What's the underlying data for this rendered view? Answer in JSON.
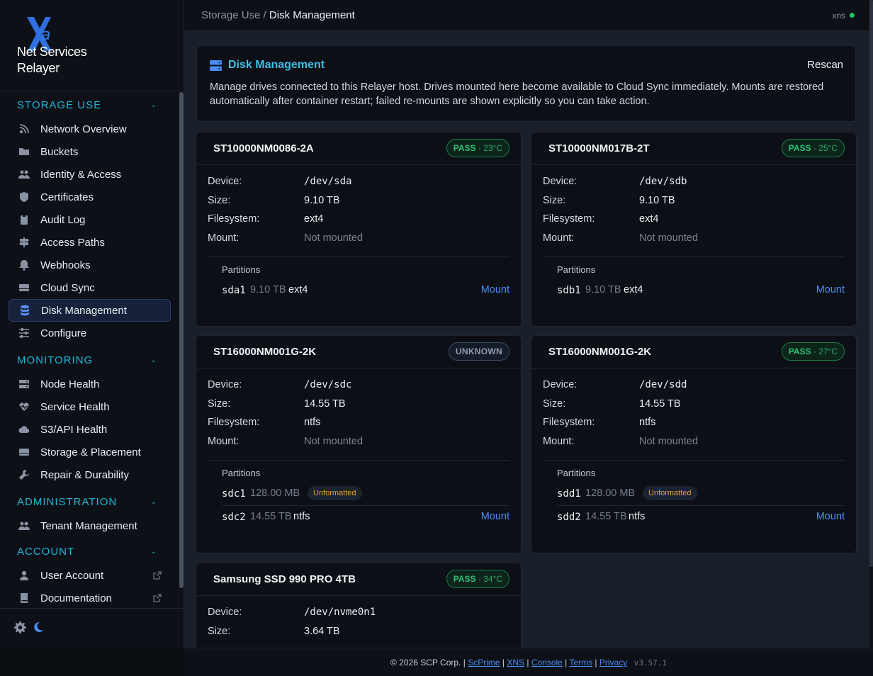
{
  "brand": {
    "line1": "Net Services",
    "line2": "Relayer"
  },
  "sidebar": {
    "sections": [
      {
        "label": "STORAGE USE",
        "items": [
          {
            "label": "Network Overview",
            "icon": "network-icon"
          },
          {
            "label": "Buckets",
            "icon": "folder-icon"
          },
          {
            "label": "Identity & Access",
            "icon": "users-icon"
          },
          {
            "label": "Certificates",
            "icon": "shield-icon"
          },
          {
            "label": "Audit Log",
            "icon": "clipboard-icon"
          },
          {
            "label": "Access Paths",
            "icon": "signpost-icon"
          },
          {
            "label": "Webhooks",
            "icon": "bell-icon"
          },
          {
            "label": "Cloud Sync",
            "icon": "drive-icon"
          },
          {
            "label": "Disk Management",
            "icon": "database-icon",
            "active": true
          },
          {
            "label": "Configure",
            "icon": "sliders-icon"
          }
        ]
      },
      {
        "label": "MONITORING",
        "items": [
          {
            "label": "Node Health",
            "icon": "server-icon"
          },
          {
            "label": "Service Health",
            "icon": "heartbeat-icon"
          },
          {
            "label": "S3/API Health",
            "icon": "cloud-icon"
          },
          {
            "label": "Storage & Placement",
            "icon": "drive-icon"
          },
          {
            "label": "Repair & Durability",
            "icon": "wrench-icon"
          }
        ]
      },
      {
        "label": "ADMINISTRATION",
        "items": [
          {
            "label": "Tenant Management",
            "icon": "users-icon"
          }
        ]
      },
      {
        "label": "ACCOUNT",
        "items": [
          {
            "label": "User Account",
            "icon": "user-icon",
            "external": true
          },
          {
            "label": "Documentation",
            "icon": "book-icon",
            "external": true
          }
        ]
      }
    ]
  },
  "topbar": {
    "crumb_parent": "Storage Use",
    "crumb_sep": " / ",
    "crumb_current": "Disk Management",
    "host": "xns",
    "status_color": "#22c55e"
  },
  "header": {
    "title": "Disk Management",
    "rescan_label": "Rescan",
    "description": "Manage drives connected to this Relayer host. Drives mounted here become available to Cloud Sync immediately. Mounts are restored automatically after container restart; failed re-mounts are shown explicitly so you can take action."
  },
  "labels": {
    "device": "Device:",
    "size": "Size:",
    "filesystem": "Filesystem:",
    "mount": "Mount:",
    "partitions": "Partitions",
    "mount_action": "Mount",
    "unformatted": "Unformatted"
  },
  "disks": [
    {
      "model": "ST10000NM0086-2A",
      "status": "PASS",
      "temp": " · 23°C",
      "device": "/dev/sda",
      "size": "9.10 TB",
      "filesystem": "ext4",
      "mount": "Not mounted",
      "partitions": [
        {
          "name": "sda1",
          "size": "9.10 TB",
          "fs": "ext4",
          "mountable": true
        }
      ]
    },
    {
      "model": "ST10000NM017B-2T",
      "status": "PASS",
      "temp": " · 25°C",
      "device": "/dev/sdb",
      "size": "9.10 TB",
      "filesystem": "ext4",
      "mount": "Not mounted",
      "partitions": [
        {
          "name": "sdb1",
          "size": "9.10 TB",
          "fs": "ext4",
          "mountable": true
        }
      ]
    },
    {
      "model": "ST16000NM001G-2K",
      "status": "UNKNOWN",
      "temp": "",
      "device": "/dev/sdc",
      "size": "14.55 TB",
      "filesystem": "ntfs",
      "mount": "Not mounted",
      "partitions": [
        {
          "name": "sdc1",
          "size": "128.00 MB",
          "fs": "",
          "unformatted": true
        },
        {
          "name": "sdc2",
          "size": "14.55 TB",
          "fs": "ntfs",
          "mountable": true
        }
      ]
    },
    {
      "model": "ST16000NM001G-2K",
      "status": "PASS",
      "temp": " · 27°C",
      "device": "/dev/sdd",
      "size": "14.55 TB",
      "filesystem": "ntfs",
      "mount": "Not mounted",
      "partitions": [
        {
          "name": "sdd1",
          "size": "128.00 MB",
          "fs": "",
          "unformatted": true
        },
        {
          "name": "sdd2",
          "size": "14.55 TB",
          "fs": "ntfs",
          "mountable": true
        }
      ]
    },
    {
      "model": "Samsung SSD 990 PRO 4TB",
      "status": "PASS",
      "temp": " · 34°C",
      "device": "/dev/nvme0n1",
      "size": "3.64 TB"
    }
  ],
  "footer": {
    "copyright": "© 2026 SCP Corp.",
    "links": [
      "ScPrime",
      "XNS",
      "Console",
      "Terms",
      "Privacy"
    ],
    "version": "v3.57.1"
  }
}
